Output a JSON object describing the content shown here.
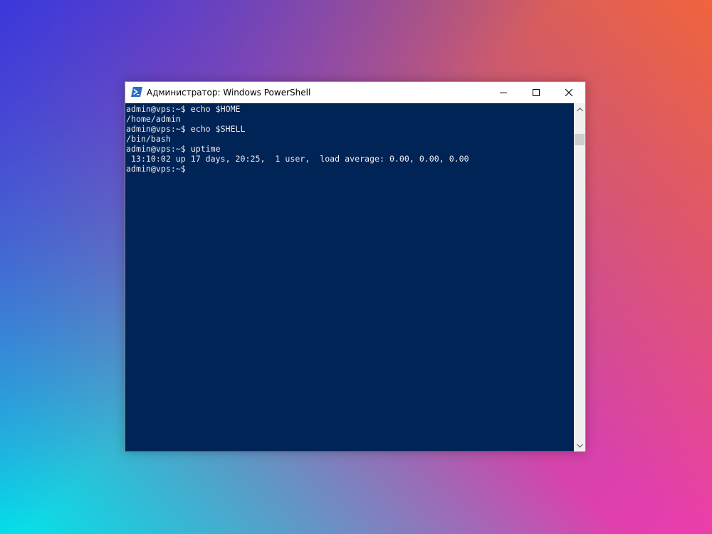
{
  "window": {
    "title": "Администратор: Windows PowerShell",
    "icon": "powershell-icon"
  },
  "controls": {
    "minimize_icon": "minimize-icon",
    "maximize_icon": "maximize-icon",
    "close_icon": "close-icon"
  },
  "console": {
    "lines": [
      "admin@vps:~$ echo $HOME",
      "/home/admin",
      "admin@vps:~$ echo $SHELL",
      "/bin/bash",
      "admin@vps:~$ uptime",
      " 13:10:02 up 17 days, 20:25,  1 user,  load average: 0.00, 0.00, 0.00",
      "admin@vps:~$"
    ]
  },
  "colors": {
    "console_background": "#012456",
    "console_text": "#eeedf0",
    "titlebar_background": "#ffffff",
    "icon_blue": "#2b6cc4"
  }
}
